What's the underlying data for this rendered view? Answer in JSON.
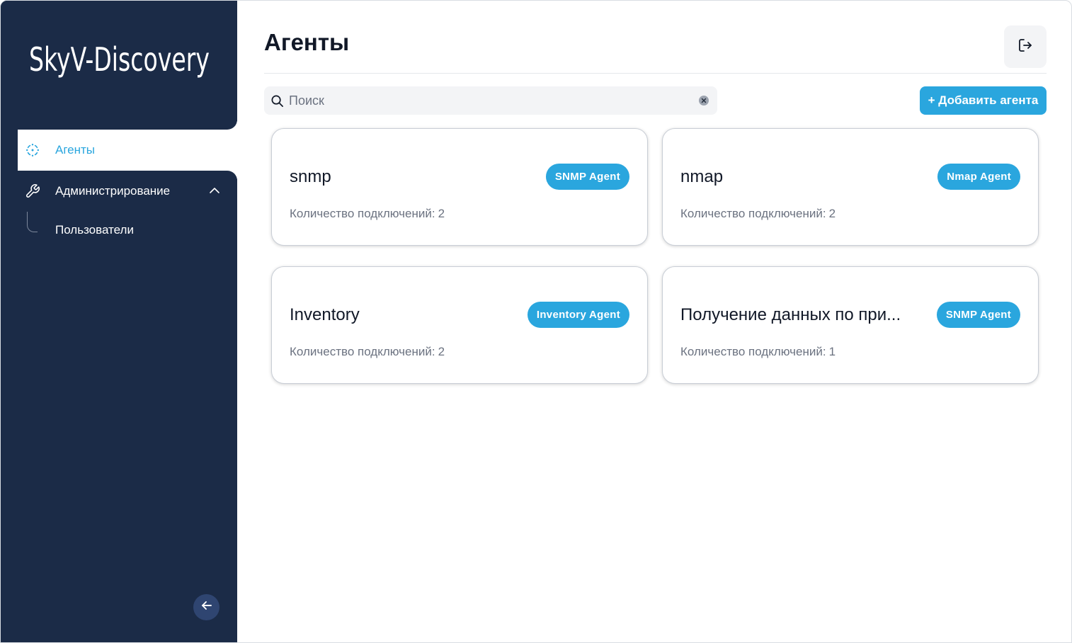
{
  "app": {
    "logo_text": "SkyV-Discovery"
  },
  "sidebar": {
    "items": [
      {
        "label": "Агенты",
        "icon": "agents-icon",
        "active": true
      },
      {
        "label": "Администрирование",
        "icon": "wrench-icon",
        "expanded": true
      },
      {
        "label": "Пользователи",
        "icon": "",
        "child": true
      }
    ],
    "collapse_icon": "arrow-left-icon"
  },
  "header": {
    "title": "Агенты",
    "logout_icon": "logout-icon"
  },
  "search": {
    "placeholder": "Поиск",
    "value": ""
  },
  "toolbar": {
    "add_label": "+ Добавить агента"
  },
  "count_label": "Количество подключений:",
  "agents": [
    {
      "name": "snmp",
      "type": "SNMP Agent",
      "connections": "2"
    },
    {
      "name": "nmap",
      "type": "Nmap Agent",
      "connections": "2"
    },
    {
      "name": "Inventory",
      "type": "Inventory Agent",
      "connections": "2"
    },
    {
      "name": "Получение данных по при...",
      "type": "SNMP Agent",
      "connections": "1"
    }
  ],
  "colors": {
    "sidebar_bg": "#1b2b47",
    "accent": "#2aa6de",
    "muted_text": "#6b7280"
  }
}
